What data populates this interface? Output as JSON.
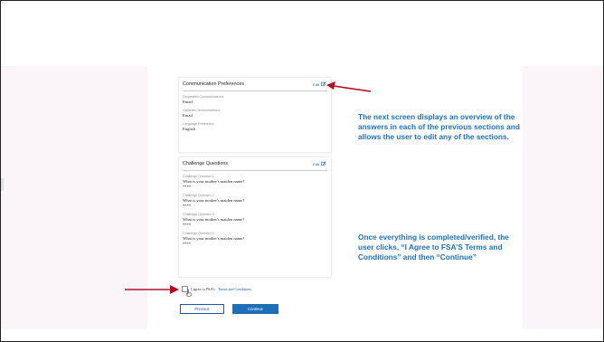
{
  "communication": {
    "title": "Communication Preferences",
    "edit_label": "Edit",
    "fields": [
      {
        "label": "Requested Communications",
        "value": "Email"
      },
      {
        "label": "Optional Communications",
        "value": "Email"
      },
      {
        "label": "Language Preference",
        "value": "English"
      }
    ]
  },
  "challenge": {
    "title": "Challenge Questions",
    "edit_label": "Edit",
    "questions": [
      {
        "label": "Challenge Question 1",
        "question": "What is your mother's maiden name?",
        "answer": "****"
      },
      {
        "label": "Challenge Question 2",
        "question": "What is your mother's maiden name?",
        "answer": "****"
      },
      {
        "label": "Challenge Question 3",
        "question": "What is your mother's maiden name?",
        "answer": "****"
      },
      {
        "label": "Challenge Question 4",
        "question": "What is your mother's maiden name?",
        "answer": "****"
      }
    ]
  },
  "agree": {
    "text": "I agree to FSA's",
    "link": "Terms and Conditions"
  },
  "buttons": {
    "previous": "Previous",
    "continue": "Continue"
  },
  "notes": {
    "overview": "The next screen displays an overview of the answers in each of the previous sections and allows the user to edit any of the sections.",
    "completed": "Once everything is completed/verified, the user clicks, “I Agree to FSA’S Terms and Conditions” and then “Continue”"
  },
  "colors": {
    "accent": "#1f6fb7",
    "arrow": "#b0101e",
    "band": "#fbf5fa"
  }
}
